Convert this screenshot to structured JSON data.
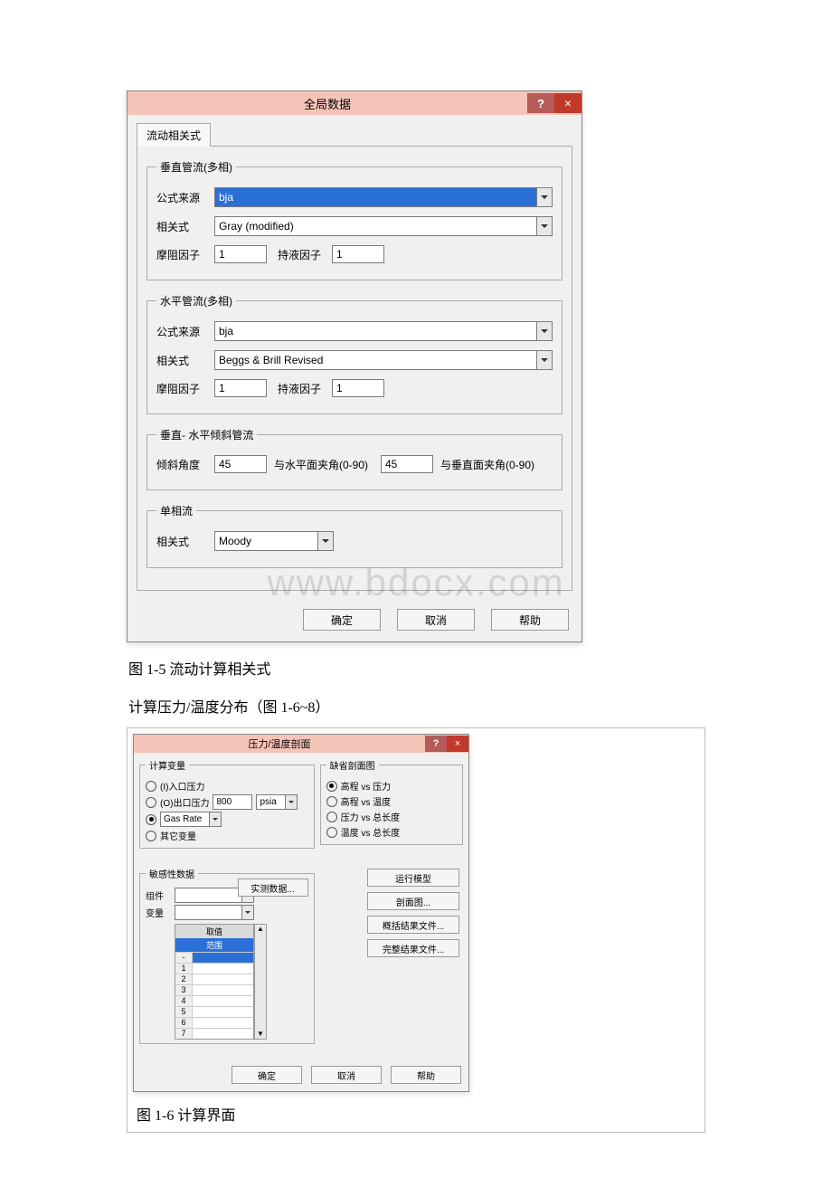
{
  "watermark": "www.bdocx.com",
  "dialog1": {
    "title": "全局数据",
    "help": "?",
    "close": "×",
    "tab_label": "流动相关式",
    "vertical": {
      "legend": "垂直管流(多相)",
      "source_label": "公式来源",
      "source_value": "bja",
      "corr_label": "相关式",
      "corr_value": "Gray (modified)",
      "friction_label": "摩阻因子",
      "friction_value": "1",
      "holdup_label": "持液因子",
      "holdup_value": "1"
    },
    "horizontal": {
      "legend": "水平管流(多相)",
      "source_label": "公式来源",
      "source_value": "bja",
      "corr_label": "相关式",
      "corr_value": "Beggs & Brill Revised",
      "friction_label": "摩阻因子",
      "friction_value": "1",
      "holdup_label": "持液因子",
      "holdup_value": "1"
    },
    "inclined": {
      "legend": "垂直- 水平倾斜管流",
      "angle_label": "倾斜角度",
      "angle_value": "45",
      "horiz_note": "与水平面夹角(0-90)",
      "vert_value": "45",
      "vert_note": "与垂直面夹角(0-90)"
    },
    "single": {
      "legend": "单相流",
      "corr_label": "相关式",
      "corr_value": "Moody"
    },
    "buttons": {
      "ok": "确定",
      "cancel": "取消",
      "help": "帮助"
    }
  },
  "caption1": "图 1-5 流动计算相关式",
  "intertext": "计算压力/温度分布（图 1-6~8）",
  "dialog2": {
    "title": "压力/温度剖面",
    "help": "?",
    "close": "×",
    "calcvar": {
      "legend": "计算变量",
      "inlet": "(I)入口压力",
      "outlet": "(O)出口压力",
      "outlet_value": "800",
      "outlet_unit": "psia",
      "rate_value": "Gas Rate",
      "other": "其它变量"
    },
    "profile": {
      "legend": "缺省剖面图",
      "opt1": "高程 vs 压力",
      "opt2": "高程 vs 温度",
      "opt3": "压力 vs 总长度",
      "opt4": "温度 vs 总长度"
    },
    "sens": {
      "legend": "敏感性数据",
      "component": "组件",
      "variable": "变量",
      "measured_btn": "实测数据...",
      "colhdr_value": "取值",
      "colhdr_range": "范围",
      "rows": [
        "1",
        "2",
        "3",
        "4",
        "5",
        "6",
        "7"
      ]
    },
    "right_buttons": {
      "run": "运行模型",
      "section": "剖面图...",
      "summary": "概括结果文件...",
      "full": "完整结果文件..."
    },
    "bottom": {
      "ok": "确定",
      "cancel": "取消",
      "help": "帮助"
    }
  },
  "caption2": "图 1-6 计算界面"
}
